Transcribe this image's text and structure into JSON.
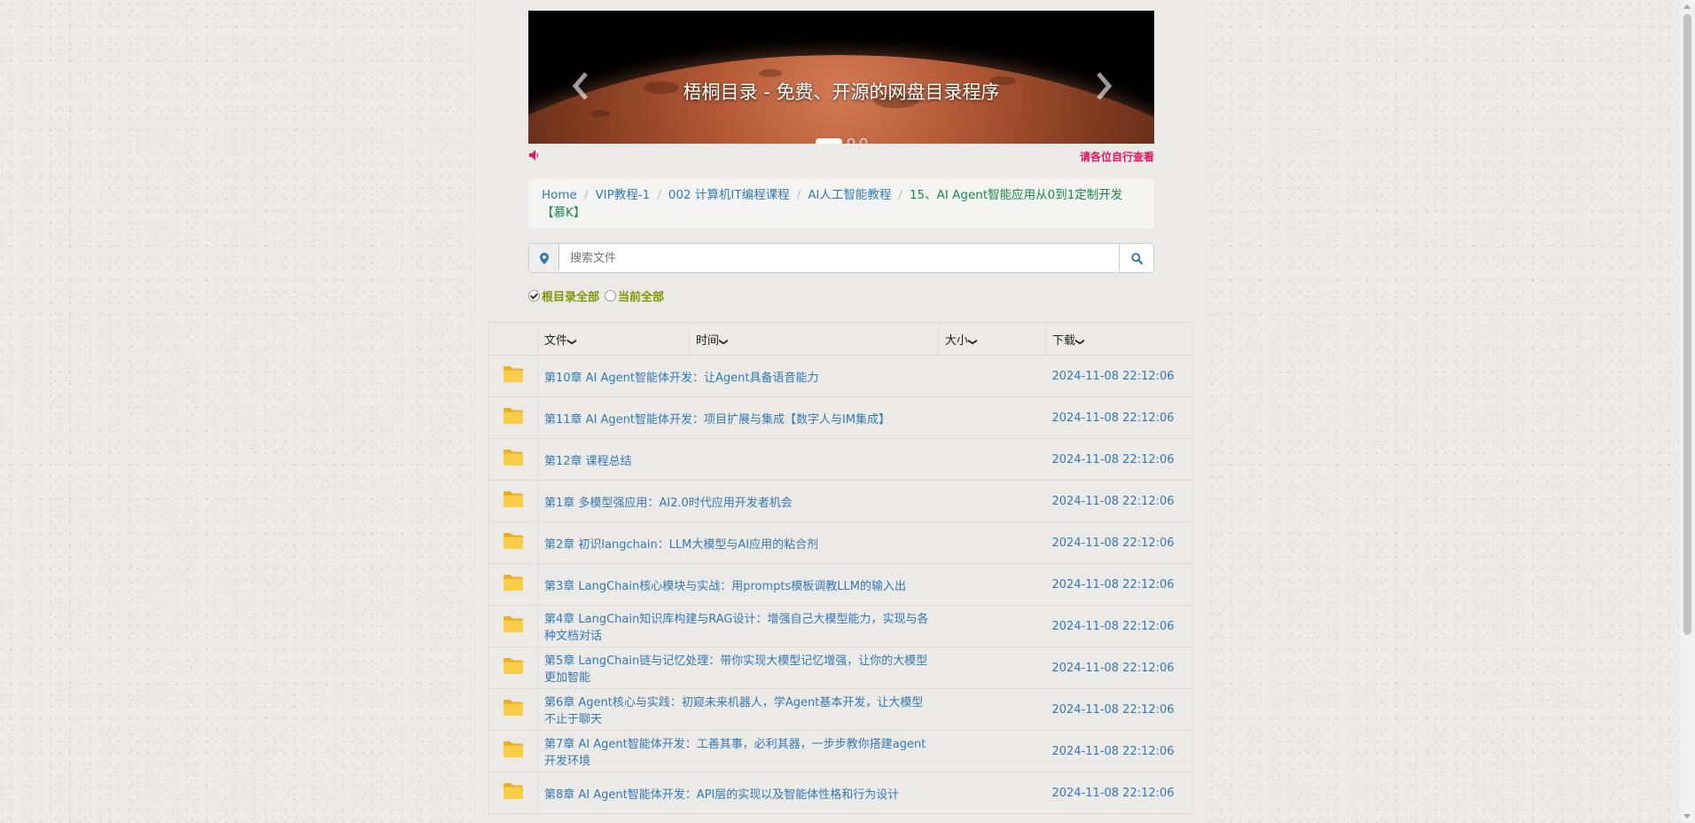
{
  "carousel": {
    "caption": "梧桐目录 - 免费、开源的网盘目录程序",
    "slide_count": 3,
    "active_slide": 1
  },
  "notice": {
    "text": "请各位自行查看"
  },
  "breadcrumb": {
    "items": [
      "Home",
      "VIP教程-1",
      "002 计算机IT编程课程",
      "AI人工智能教程"
    ],
    "current": "15、AI Agent智能应用从0到1定制开发【慕K】"
  },
  "search": {
    "placeholder": "搜索文件",
    "value": ""
  },
  "scope": {
    "options": [
      "根目录全部",
      "当前全部"
    ],
    "selected": "根目录全部"
  },
  "table": {
    "headers": {
      "file": "文件",
      "time": "时间",
      "size": "大小",
      "download": "下载"
    },
    "rows": [
      {
        "name": "第10章 AI Agent智能体开发：让Agent具备语音能力",
        "time": "2024-11-08 22:12:06"
      },
      {
        "name": "第11章 AI Agent智能体开发：项目扩展与集成【数字人与IM集成】",
        "time": "2024-11-08 22:12:06"
      },
      {
        "name": "第12章 课程总结",
        "time": "2024-11-08 22:12:06"
      },
      {
        "name": "第1章 多模型强应用：AI2.0时代应用开发者机会",
        "time": "2024-11-08 22:12:06"
      },
      {
        "name": "第2章 初识langchain：LLM大模型与AI应用的粘合剂",
        "time": "2024-11-08 22:12:06"
      },
      {
        "name": "第3章 LangChain核心模块与实战：用prompts模板调教LLM的输入出",
        "time": "2024-11-08 22:12:06"
      },
      {
        "name": "第4章 LangChain知识库构建与RAG设计：增强自己大模型能力，实现与各种文档对话",
        "time": "2024-11-08 22:12:06"
      },
      {
        "name": "第5章 LangChain链与记忆处理：带你实现大模型记忆增强，让你的大模型更加智能",
        "time": "2024-11-08 22:12:06"
      },
      {
        "name": "第6章 Agent核心与实践：初窥未来机器人，学Agent基本开发，让大模型不止于聊天",
        "time": "2024-11-08 22:12:06"
      },
      {
        "name": "第7章 AI Agent智能体开发：工善其事，必利其器，一步步教你搭建agent开发环境",
        "time": "2024-11-08 22:12:06"
      },
      {
        "name": "第8章 AI Agent智能体开发：API层的实现以及智能体性格和行为设计",
        "time": "2024-11-08 22:12:06"
      }
    ]
  },
  "colors": {
    "link": "#337ab7",
    "current_crumb": "#1b8a4a",
    "notice": "#e6155f",
    "scope_label": "#7a9a00",
    "folder": "#f5c338"
  },
  "icons": {
    "carousel_prev": "chevron-left-icon",
    "carousel_next": "chevron-right-icon",
    "notice": "speaker-icon",
    "search_addon": "map-marker-icon",
    "search_button": "search-icon",
    "row": "folder-icon",
    "sort": "chevron-down-icon"
  }
}
